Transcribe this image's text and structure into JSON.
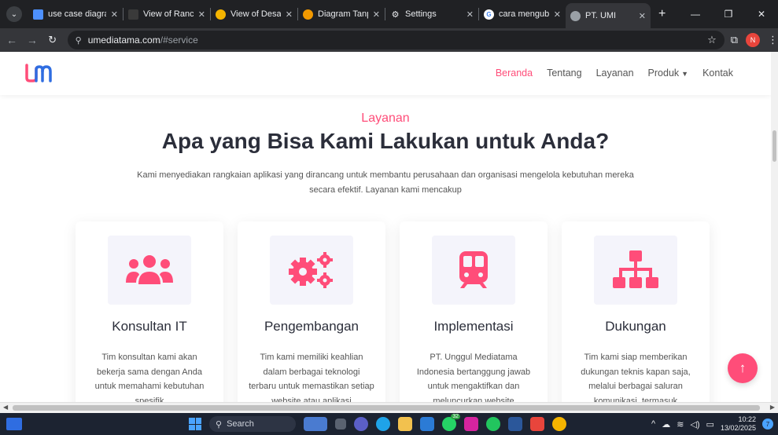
{
  "browser": {
    "tabs": [
      {
        "title": "use case diagram",
        "favicon_color": "#4d90fe",
        "active": false
      },
      {
        "title": "View of Rancang",
        "favicon_color": "#3a3a3a",
        "active": false
      },
      {
        "title": "View of Desain I",
        "favicon_color": "#f4b400",
        "active": false
      },
      {
        "title": "Diagram Tanpa J",
        "favicon_color": "#f29900",
        "active": false
      },
      {
        "title": "Settings",
        "favicon_color": "#9aa0a6",
        "active": false
      },
      {
        "title": "cara mengubah",
        "favicon_color": "#4285f4",
        "active": false
      },
      {
        "title": "PT. UMI",
        "favicon_color": "#9aa0a6",
        "active": true
      }
    ],
    "url_host": "umediatama.com",
    "url_path": "/#service",
    "profile_initial": "N"
  },
  "site": {
    "menu": [
      {
        "label": "Beranda",
        "active": true
      },
      {
        "label": "Tentang",
        "active": false
      },
      {
        "label": "Layanan",
        "active": false
      },
      {
        "label": "Produk",
        "active": false,
        "dropdown": true
      },
      {
        "label": "Kontak",
        "active": false
      }
    ],
    "section": {
      "kicker": "Layanan",
      "heading": "Apa yang Bisa Kami Lakukan untuk Anda?",
      "lead": "Kami menyediakan rangkaian aplikasi yang dirancang untuk membantu perusahaan dan organisasi mengelola kebutuhan mereka secara efektif. Layanan kami mencakup"
    },
    "cards": [
      {
        "title": "Konsultan IT",
        "icon": "users-icon",
        "desc": "Tim konsultan kami akan bekerja sama dengan Anda untuk memahami kebutuhan spesifik"
      },
      {
        "title": "Pengembangan",
        "icon": "gears-icon",
        "desc": "Tim kami memiliki keahlian dalam berbagai teknologi terbaru untuk memastikan setiap website atau aplikasi"
      },
      {
        "title": "Implementasi",
        "icon": "train-icon",
        "desc": "PT. Unggul Mediatama Indonesia bertanggung jawab untuk mengaktifkan dan meluncurkan website"
      },
      {
        "title": "Dukungan",
        "icon": "sitemap-icon",
        "desc": "Tim kami siap memberikan dukungan teknis kapan saja, melalui berbagai saluran komunikasi, termasuk"
      }
    ],
    "accent_color": "#ff4d79"
  },
  "taskbar": {
    "search_label": "Search",
    "badge_count": "32",
    "time": "10:22",
    "date": "13/02/2025",
    "notifications": "7"
  }
}
